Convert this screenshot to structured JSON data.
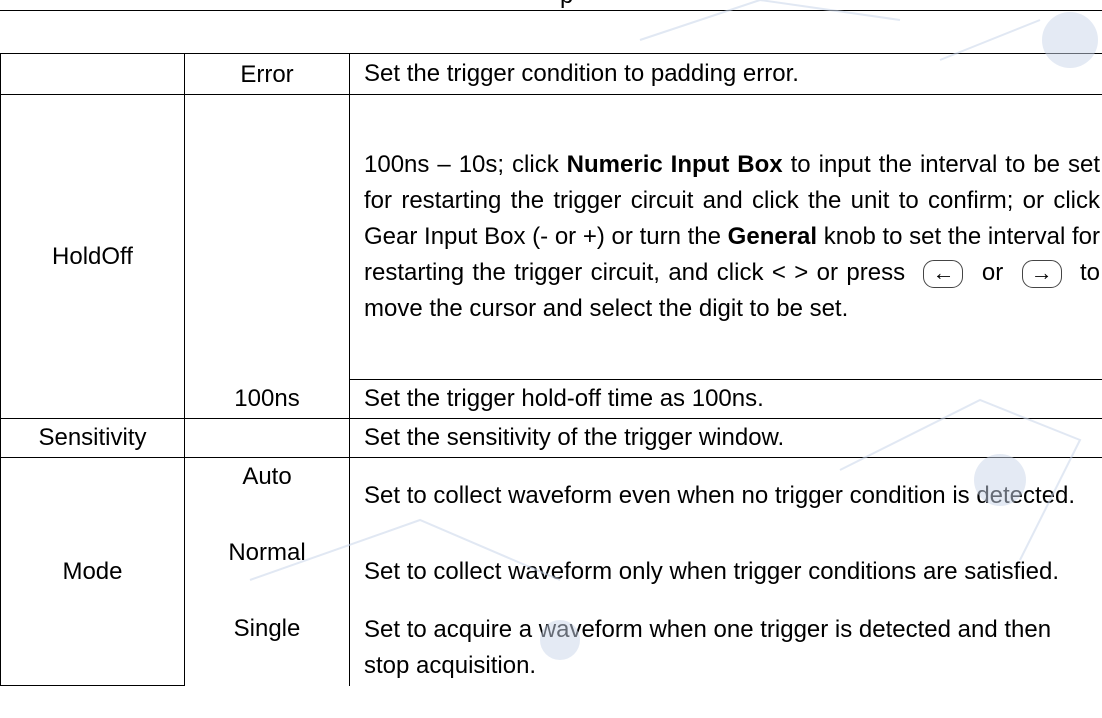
{
  "header_fragment": "p",
  "rows": [
    {
      "param": "",
      "option": "Error",
      "description": "Set the trigger condition to padding error."
    },
    {
      "param": "HoldOff",
      "option": "",
      "description_parts": {
        "p1": "100ns – 10s; click ",
        "b1": "Numeric Input Box",
        "p2": " to input the interval to be set for restarting the trigger circuit and click the unit to confirm; or click Gear Input Box (- or +) or turn the ",
        "b2": "General",
        "p3": " knob to set the interval for restarting the trigger circuit, and click < > or press ",
        "or": " or ",
        "p4": " to move the cursor and select the digit to be set."
      }
    },
    {
      "param": "",
      "option": "100ns",
      "description": "Set the trigger hold-off time as 100ns."
    },
    {
      "param": "Sensitivity",
      "option": "",
      "description": "Set the sensitivity of the trigger window."
    },
    {
      "param": "",
      "option": "Auto",
      "description": "Set to collect waveform even when no trigger condition is detected."
    },
    {
      "param": "Mode",
      "option": "Normal",
      "description": "Set to collect waveform only when trigger conditions are satisfied."
    },
    {
      "param": "",
      "option": "Single",
      "description": "Set to acquire a waveform when one trigger is detected and then stop acquisition."
    }
  ],
  "keys": {
    "left": "←",
    "right": "→"
  },
  "watermark": {
    "color": "#c9d6ea"
  }
}
